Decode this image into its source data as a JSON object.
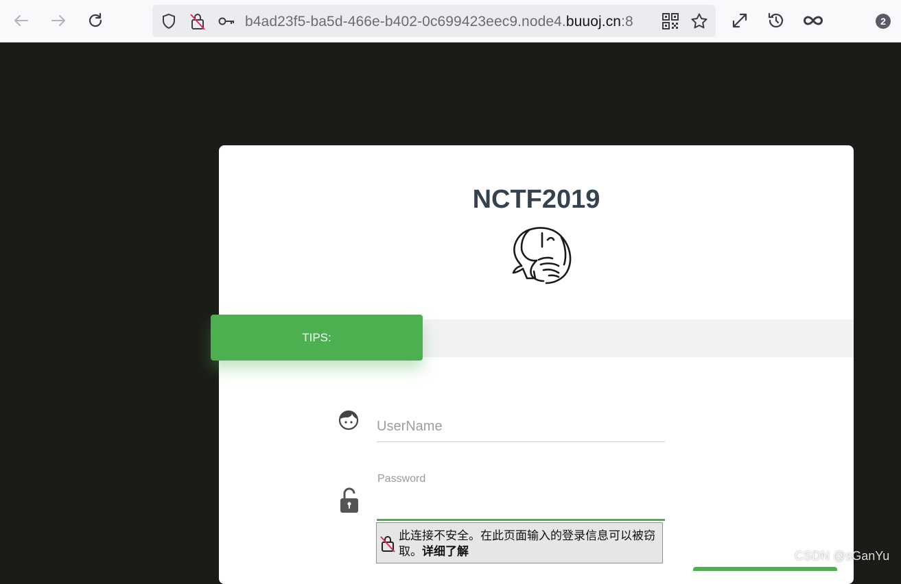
{
  "browser": {
    "url_prefix": "b4ad23f5-ba5d-466e-b402-0c699423eec9.node4.",
    "url_domain": "buuoj.cn",
    "url_suffix": ":8",
    "tab_count_badge": "2",
    "icons": [
      "back-arrow-icon",
      "forward-arrow-icon",
      "reload-icon",
      "shield-icon",
      "insecure-lock-icon",
      "key-icon",
      "qr-code-icon",
      "star-icon",
      "expand-icon",
      "history-icon",
      "infinity-icon"
    ]
  },
  "page": {
    "title": "NCTF2019",
    "tips_label": "TIPS:",
    "username_placeholder": "UserName",
    "password_label": "Password",
    "accent_color": "#4caf50"
  },
  "insecure_warning": {
    "text": "此连接不安全。在此页面输入的登录信息可以被窃取。",
    "link": "详细了解"
  },
  "watermark": "CSDN @sGanYu"
}
